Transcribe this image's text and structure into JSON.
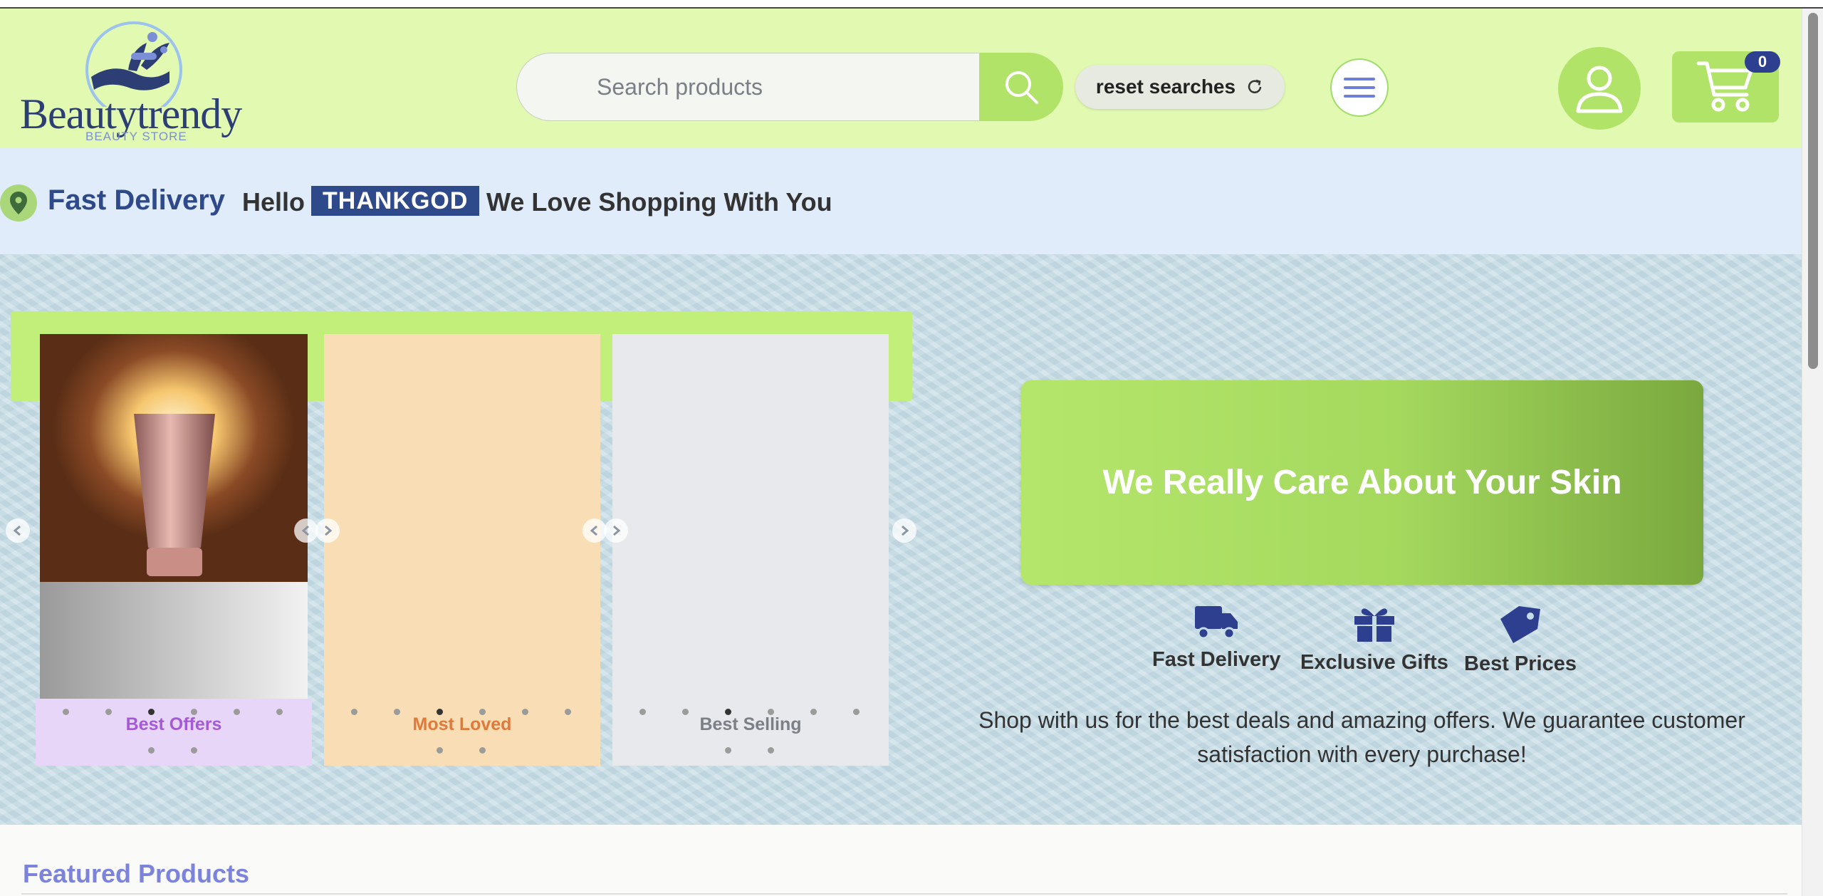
{
  "header": {
    "logo_text": "Beautytrendy",
    "logo_sub": "BEAUTY STORE",
    "search_placeholder": "Search products",
    "reset_label": "reset searches",
    "cart_count": "0"
  },
  "delivery": {
    "title": "Fast Delivery",
    "hello": "Hello",
    "username": "THANKGOD",
    "message": "We Love Shopping With You"
  },
  "carousels": [
    {
      "label": "Best Offers",
      "label_color": "#a45ad6",
      "bg": "#e7d6f7"
    },
    {
      "label": "Most Loved",
      "label_color": "#e07a3a",
      "bg": "#f9ddb4"
    },
    {
      "label": "Best Selling",
      "label_color": "#7b7f86",
      "bg": "#e8e9ec"
    }
  ],
  "hero": {
    "cta": "We Really Care About Your Skin",
    "features": [
      {
        "label": "Fast Delivery",
        "icon": "truck-icon"
      },
      {
        "label": "Exclusive Gifts",
        "icon": "gift-icon"
      },
      {
        "label": "Best Prices",
        "icon": "tags-icon"
      }
    ],
    "description": "Shop with us for the best deals and amazing offers. We guarantee customer satisfaction with every purchase!"
  },
  "featured": {
    "title": "Featured Products"
  },
  "colors": {
    "accent_green": "#b2e369",
    "navy": "#2f4a8a",
    "featured_purple": "#7b83db"
  }
}
